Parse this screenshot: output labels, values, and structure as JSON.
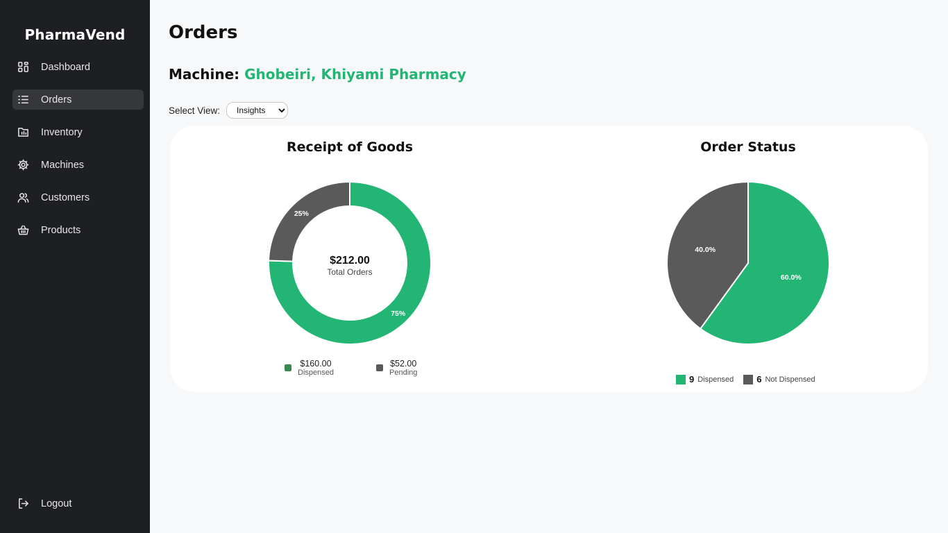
{
  "app": {
    "name": "PharmaVend"
  },
  "sidebar": {
    "items": [
      {
        "label": "Dashboard",
        "icon": "dashboard-grid-icon",
        "active": false
      },
      {
        "label": "Orders",
        "icon": "list-icon",
        "active": true
      },
      {
        "label": "Inventory",
        "icon": "inventory-folder-icon",
        "active": false
      },
      {
        "label": "Machines",
        "icon": "gear-icon",
        "active": false
      },
      {
        "label": "Customers",
        "icon": "users-icon",
        "active": false
      },
      {
        "label": "Products",
        "icon": "basket-icon",
        "active": false
      }
    ],
    "logout": {
      "label": "Logout",
      "icon": "logout-icon"
    }
  },
  "page": {
    "title": "Orders",
    "machine_prefix": "Machine:",
    "machine_name": "Ghobeiri, Khiyami Pharmacy",
    "select_view_label": "Select View:",
    "select_view_value": "Insights"
  },
  "colors": {
    "accent": "#22b573",
    "secondary": "#5a5a5a",
    "sidebar_bg": "#1e1f23"
  },
  "chart_data": [
    {
      "type": "donut",
      "title": "Receipt of Goods",
      "center_value": "$212.00",
      "center_label": "Total Orders",
      "categories": [
        "Dispensed",
        "Pending"
      ],
      "values": [
        160,
        52
      ],
      "percent_labels": [
        "75%",
        "25%"
      ],
      "legend": [
        {
          "value": "$160.00",
          "label": "Dispensed"
        },
        {
          "value": "$52.00",
          "label": "Pending"
        }
      ],
      "colors": [
        "#22b573",
        "#5a5a5a"
      ]
    },
    {
      "type": "pie",
      "title": "Order Status",
      "categories": [
        "Dispensed",
        "Not Dispensed"
      ],
      "values": [
        9,
        6
      ],
      "percent_labels": [
        "60.0%",
        "40.0%"
      ],
      "legend": [
        {
          "count": "9",
          "label": "Dispensed"
        },
        {
          "count": "6",
          "label": "Not Dispensed"
        }
      ],
      "colors": [
        "#22b573",
        "#5a5a5a"
      ]
    }
  ]
}
